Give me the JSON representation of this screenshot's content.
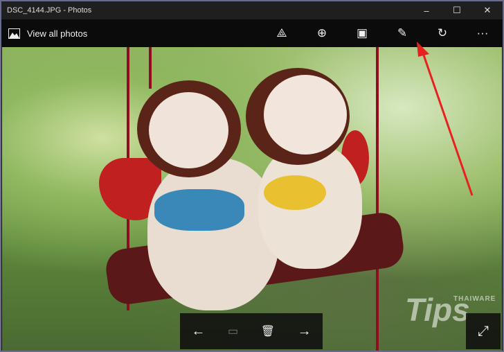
{
  "window": {
    "title": "DSC_4144.JPG - Photos",
    "minimize": "–",
    "maximize": "☐",
    "close": "✕"
  },
  "toolbar": {
    "back_label": "View all photos",
    "share": "⟁",
    "zoom": "⊕",
    "slideshow": "▣",
    "edit": "✎",
    "rotate": "↻",
    "more": "···"
  },
  "bottom": {
    "prev": "←",
    "lens": "▭",
    "delete": "🗑",
    "next": "→",
    "fullscreen": "⤢"
  },
  "watermark": {
    "brand": "THAIWARE",
    "text": "Tips"
  },
  "colors": {
    "annotation": "#e82020"
  }
}
